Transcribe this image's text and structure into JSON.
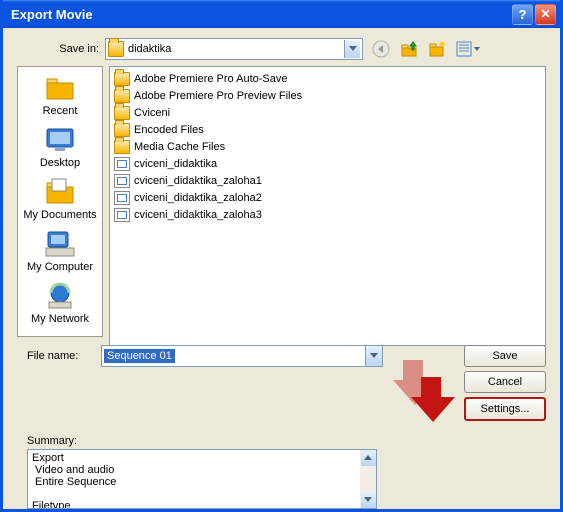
{
  "window": {
    "title": "Export Movie"
  },
  "savein": {
    "label": "Save in:",
    "folder": "didaktika"
  },
  "places": [
    {
      "key": "recent",
      "label": "Recent"
    },
    {
      "key": "desktop",
      "label": "Desktop"
    },
    {
      "key": "mydocs",
      "label": "My Documents"
    },
    {
      "key": "mycomp",
      "label": "My Computer"
    },
    {
      "key": "mynet",
      "label": "My Network"
    }
  ],
  "files": [
    {
      "type": "folder",
      "name": "Adobe Premiere Pro Auto-Save"
    },
    {
      "type": "folder",
      "name": "Adobe Premiere Pro Preview Files"
    },
    {
      "type": "folder",
      "name": "Cviceni"
    },
    {
      "type": "folder",
      "name": "Encoded Files"
    },
    {
      "type": "folder",
      "name": "Media Cache Files"
    },
    {
      "type": "proj",
      "name": "cviceni_didaktika"
    },
    {
      "type": "proj",
      "name": "cviceni_didaktika_zaloha1"
    },
    {
      "type": "proj",
      "name": "cviceni_didaktika_zaloha2"
    },
    {
      "type": "proj",
      "name": "cviceni_didaktika_zaloha3"
    }
  ],
  "filename": {
    "label": "File name:",
    "value": "Sequence 01"
  },
  "buttons": {
    "save": "Save",
    "cancel": "Cancel",
    "settings": "Settings..."
  },
  "summary": {
    "label": "Summary:",
    "lines": [
      "Export",
      " Video and audio",
      " Entire Sequence",
      "",
      "Filetype"
    ]
  }
}
